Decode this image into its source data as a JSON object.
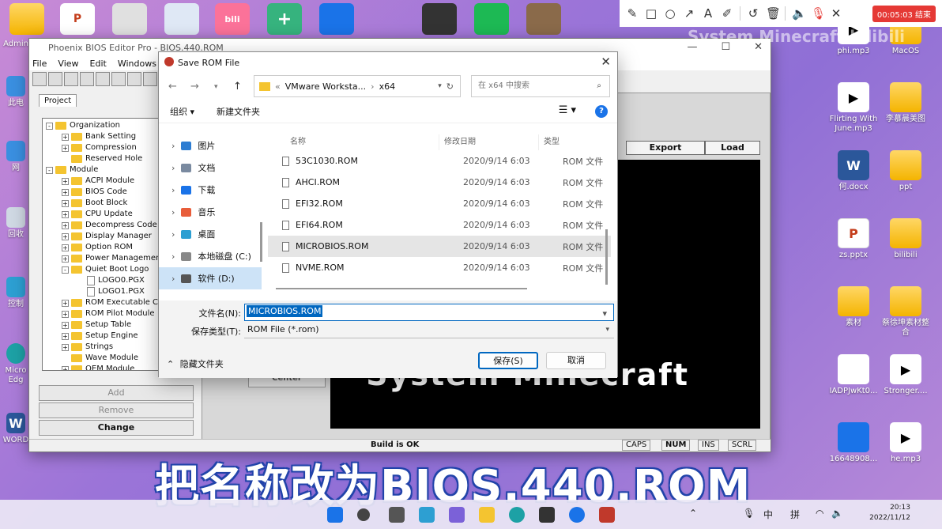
{
  "desktop": {
    "left_labels": [
      "Admin",
      "此电",
      "网",
      "回收",
      "控制",
      "Micro Edg",
      "WORD"
    ],
    "right_icons": [
      {
        "label": "phi.mp3",
        "kind": "mp3"
      },
      {
        "label": "MacOS",
        "kind": "folder"
      },
      {
        "label": "Flirting With June.mp3",
        "kind": "mp3"
      },
      {
        "label": "李慕晨美图",
        "kind": "folder"
      },
      {
        "label": "何.docx",
        "kind": "word"
      },
      {
        "label": "ppt",
        "kind": "folder"
      },
      {
        "label": "zs.pptx",
        "kind": "ppt"
      },
      {
        "label": "bilibili",
        "kind": "folder"
      },
      {
        "label": "素材",
        "kind": "folder"
      },
      {
        "label": "蔡徐坤素材整合",
        "kind": "folder"
      },
      {
        "label": "IADPJwKt0...",
        "kind": "img"
      },
      {
        "label": "Stronger....",
        "kind": "mp3"
      },
      {
        "label": "16648908...",
        "kind": "win"
      },
      {
        "label": "he.mp3",
        "kind": "mp3"
      }
    ],
    "watermark": "System Minecraft  bilibili"
  },
  "annotation_toolbar": {
    "tools": [
      "pen-icon",
      "rectangle-icon",
      "circle-icon",
      "arrow-icon",
      "text-icon",
      "highlighter-icon",
      "undo-icon",
      "trash-icon",
      "speaker-icon",
      "mic-off-icon",
      "close-icon"
    ],
    "record_label": "00:05:03 结束"
  },
  "phoenix": {
    "title": "Phoenix BIOS Editor Pro - BIOS.440.ROM",
    "menu": [
      "File",
      "View",
      "Edit",
      "Windows",
      "H"
    ],
    "project_tab": "Project",
    "tree": [
      {
        "label": "Organization",
        "level": 0,
        "kind": "folder",
        "ex": "-"
      },
      {
        "label": "Bank Setting",
        "level": 1,
        "kind": "folder",
        "ex": "+"
      },
      {
        "label": "Compression",
        "level": 1,
        "kind": "folder",
        "ex": "+"
      },
      {
        "label": "Reserved Hole",
        "level": 1,
        "kind": "folder",
        "ex": ""
      },
      {
        "label": "Module",
        "level": 0,
        "kind": "folder",
        "ex": "-"
      },
      {
        "label": "ACPI Module",
        "level": 1,
        "kind": "folder",
        "ex": "+"
      },
      {
        "label": "BIOS Code",
        "level": 1,
        "kind": "folder",
        "ex": "+"
      },
      {
        "label": "Boot Block",
        "level": 1,
        "kind": "folder",
        "ex": "+"
      },
      {
        "label": "CPU Update",
        "level": 1,
        "kind": "folder",
        "ex": "+"
      },
      {
        "label": "Decompress Code",
        "level": 1,
        "kind": "folder",
        "ex": "+"
      },
      {
        "label": "Display Manager",
        "level": 1,
        "kind": "folder",
        "ex": "+"
      },
      {
        "label": "Option ROM",
        "level": 1,
        "kind": "folder",
        "ex": "+"
      },
      {
        "label": "Power Management",
        "level": 1,
        "kind": "folder",
        "ex": "+"
      },
      {
        "label": "Quiet Boot Logo",
        "level": 1,
        "kind": "folder",
        "ex": "-"
      },
      {
        "label": "LOGO0.PGX",
        "level": 2,
        "kind": "file",
        "ex": ""
      },
      {
        "label": "LOGO1.PGX",
        "level": 2,
        "kind": "file",
        "ex": ""
      },
      {
        "label": "ROM Executable Co",
        "level": 1,
        "kind": "folder",
        "ex": "+"
      },
      {
        "label": "ROM Pilot Module",
        "level": 1,
        "kind": "folder",
        "ex": "+"
      },
      {
        "label": "Setup Table",
        "level": 1,
        "kind": "folder",
        "ex": "+"
      },
      {
        "label": "Setup Engine",
        "level": 1,
        "kind": "folder",
        "ex": "+"
      },
      {
        "label": "Strings",
        "level": 1,
        "kind": "folder",
        "ex": "+"
      },
      {
        "label": "Wave Module",
        "level": 1,
        "kind": "folder",
        "ex": ""
      },
      {
        "label": "OEM Module",
        "level": 1,
        "kind": "folder",
        "ex": "+"
      }
    ],
    "buttons": {
      "add": "Add",
      "remove": "Remove",
      "change": "Change",
      "center": "Center"
    },
    "headers": {
      "export": "Export",
      "load": "Load"
    },
    "black_text": "System Minecraft",
    "status": {
      "build": "Build is OK",
      "indicators": [
        "CAPS",
        "NUM",
        "INS",
        "SCRL"
      ]
    }
  },
  "dialog": {
    "title": "Save ROM File",
    "path": [
      "VMware Worksta...",
      "x64"
    ],
    "search_placeholder": "在 x64 中搜索",
    "organize": "组织 ▾",
    "new_folder": "新建文件夹",
    "nav": [
      {
        "label": "图片",
        "color": "#2d7dd2"
      },
      {
        "label": "文档",
        "color": "#7a8aa0"
      },
      {
        "label": "下载",
        "color": "#1a73e8"
      },
      {
        "label": "音乐",
        "color": "#e85d3a"
      },
      {
        "label": "桌面",
        "color": "#2d9fd2"
      },
      {
        "label": "本地磁盘 (C:)",
        "color": "#888888"
      },
      {
        "label": "软件 (D:)",
        "color": "#555555"
      }
    ],
    "columns": {
      "name": "名称",
      "date": "修改日期",
      "type": "类型"
    },
    "files": [
      {
        "name": "53C1030.ROM",
        "date": "2020/9/14 6:03",
        "type": "ROM 文件"
      },
      {
        "name": "AHCI.ROM",
        "date": "2020/9/14 6:03",
        "type": "ROM 文件"
      },
      {
        "name": "EFI32.ROM",
        "date": "2020/9/14 6:03",
        "type": "ROM 文件"
      },
      {
        "name": "EFI64.ROM",
        "date": "2020/9/14 6:03",
        "type": "ROM 文件"
      },
      {
        "name": "MICROBIOS.ROM",
        "date": "2020/9/14 6:03",
        "type": "ROM 文件"
      },
      {
        "name": "NVME.ROM",
        "date": "2020/9/14 6:03",
        "type": "ROM 文件"
      }
    ],
    "selected_index": 4,
    "filename_label": "文件名(N):",
    "filename_value": "MICROBIOS.ROM",
    "filetype_label": "保存类型(T):",
    "filetype_value": "ROM File (*.rom)",
    "hide_folders": "隐藏文件夹",
    "save": "保存(S)",
    "cancel": "取消"
  },
  "subtitle": "把名称改为BIOS.440.ROM",
  "taskbar": {
    "tray": [
      "中",
      "拼"
    ],
    "time": "20:13",
    "date": "2022/11/12"
  }
}
